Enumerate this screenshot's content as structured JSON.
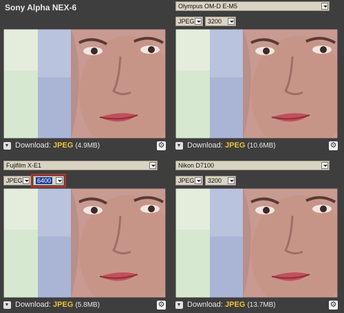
{
  "panels": [
    {
      "title": "Sony Alpha NEX-6",
      "download_label": "Download:",
      "format": "JPEG",
      "size": "(4.9MB)"
    },
    {
      "camera_select": "Olympus OM-D E-M5",
      "format_select": "JPEG",
      "iso_select": "3200",
      "download_label": "Download:",
      "format": "JPEG",
      "size": "(10.6MB)"
    },
    {
      "camera_select": "Fujifilm X-E1",
      "format_select": "JPEG",
      "iso_select": "6400",
      "download_label": "Download:",
      "format": "JPEG",
      "size": "(5.8MB)"
    },
    {
      "camera_select": "Nikon D7100",
      "format_select": "JPEG",
      "iso_select": "3200",
      "download_label": "Download:",
      "format": "JPEG",
      "size": "(13.7MB)"
    }
  ],
  "colors": {
    "background": "#3e3e3e",
    "jpeg_accent": "#f0c23a",
    "select_bg": "#d9d3c3",
    "highlight_border": "#c0302a"
  },
  "icons": [
    "download-icon",
    "gear-icon",
    "dropdown-arrow-icon"
  ]
}
